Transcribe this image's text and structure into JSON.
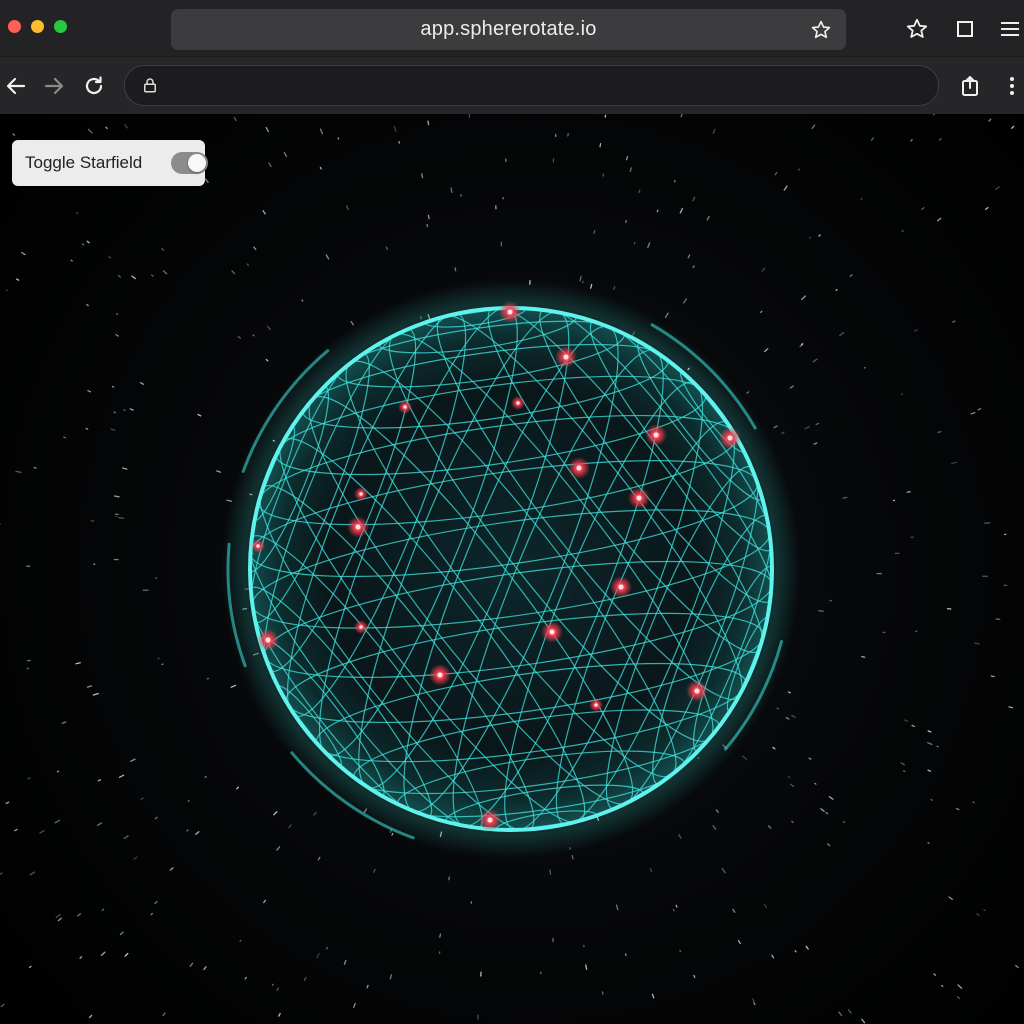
{
  "browser": {
    "domain": "app.sphererotate.io",
    "address_value": "",
    "colors": {
      "titlebar": "#232325",
      "toolbar": "#262628"
    }
  },
  "controls": {
    "toggle_starfield": {
      "label": "Toggle Starfield",
      "enabled": true
    }
  },
  "scene": {
    "wireframe_color": "#3ee6e0",
    "node_color": "#ff3b4e",
    "background": "#000000",
    "icons": [
      "back-arrow-icon",
      "forward-arrow-icon",
      "reload-icon",
      "lock-icon",
      "share-icon",
      "more-vertical-icon",
      "star-icon",
      "window-icon",
      "menu-icon"
    ]
  }
}
